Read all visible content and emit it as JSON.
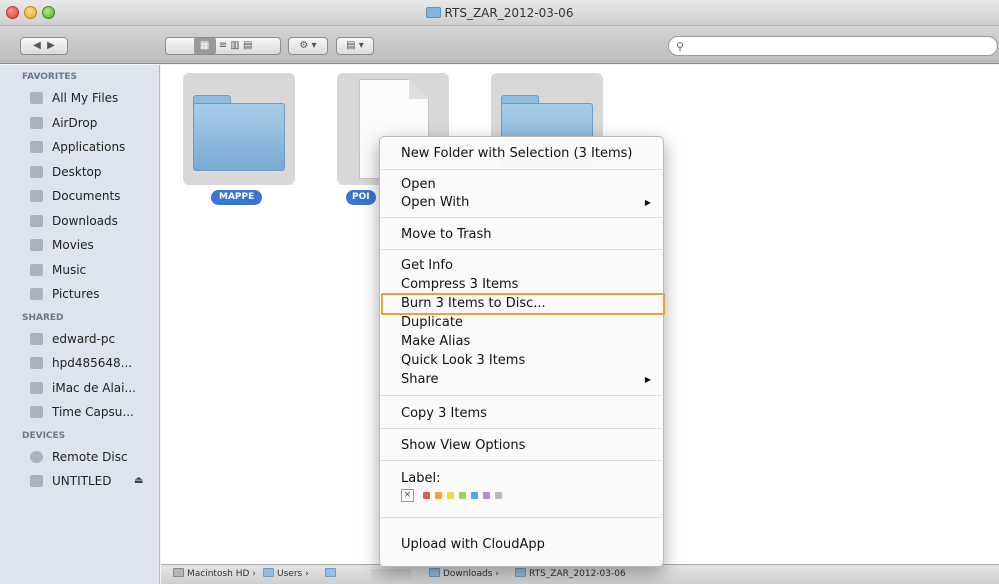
{
  "window": {
    "title": "RTS_ZAR_2012-03-06"
  },
  "toolbar": {
    "search_placeholder": ""
  },
  "sidebar": {
    "favorites_header": "FAVORITES",
    "favorites": [
      {
        "label": "All My Files",
        "icon": "all-files-icon"
      },
      {
        "label": "AirDrop",
        "icon": "airdrop-icon"
      },
      {
        "label": "Applications",
        "icon": "applications-icon"
      },
      {
        "label": "Desktop",
        "icon": "desktop-icon"
      },
      {
        "label": "Documents",
        "icon": "documents-icon"
      },
      {
        "label": "Downloads",
        "icon": "downloads-icon"
      },
      {
        "label": "Movies",
        "icon": "movies-icon"
      },
      {
        "label": "Music",
        "icon": "music-icon"
      },
      {
        "label": "Pictures",
        "icon": "pictures-icon"
      }
    ],
    "shared_header": "SHARED",
    "shared": [
      {
        "label": "edward-pc"
      },
      {
        "label": "hpd485648..."
      },
      {
        "label": "iMac de Alai..."
      },
      {
        "label": "Time Capsu..."
      }
    ],
    "devices_header": "DEVICES",
    "devices": [
      {
        "label": "Remote Disc"
      },
      {
        "label": "UNTITLED",
        "eject": "⏏"
      }
    ]
  },
  "content": {
    "items": [
      {
        "name": "MAPPE",
        "kind": "folder"
      },
      {
        "name": "POI",
        "kind": "document"
      },
      {
        "name": "",
        "kind": "folder"
      }
    ]
  },
  "pathbar": {
    "segments": [
      "Macintosh HD",
      "Users",
      "Downloads",
      "RTS_ZAR_2012-03-06"
    ],
    "separator": "›"
  },
  "context_menu": {
    "new_folder": "New Folder with Selection (3 Items)",
    "open": "Open",
    "open_with": "Open With",
    "move_to_trash": "Move to Trash",
    "get_info": "Get Info",
    "compress": "Compress 3 Items",
    "burn": "Burn 3 Items to Disc...",
    "duplicate": "Duplicate",
    "make_alias": "Make Alias",
    "quick_look": "Quick Look 3 Items",
    "share": "Share",
    "copy": "Copy 3 Items",
    "show_view_options": "Show View Options",
    "label_heading": "Label:",
    "label_none": "×",
    "label_colors": [
      "#e05a4f",
      "#f0a43a",
      "#eed94a",
      "#9bd45a",
      "#5aa0e8",
      "#b58ad6",
      "#b8b8b8"
    ],
    "upload": "Upload with CloudApp"
  },
  "highlight_color": "#e8a33a",
  "accent": "#3b74d1"
}
